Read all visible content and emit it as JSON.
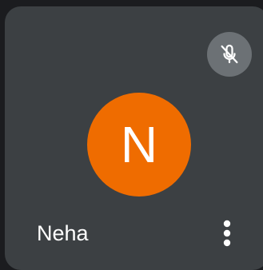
{
  "participant": {
    "name": "Neha",
    "avatar_initial": "N",
    "avatar_color": "#ef6c00",
    "mic_status": "muted"
  },
  "icons": {
    "mute": "mic-off-icon",
    "more": "more-vert-icon"
  },
  "colors": {
    "tile_background": "#3c4043",
    "mute_badge": "#6c7175",
    "text": "#ffffff"
  }
}
